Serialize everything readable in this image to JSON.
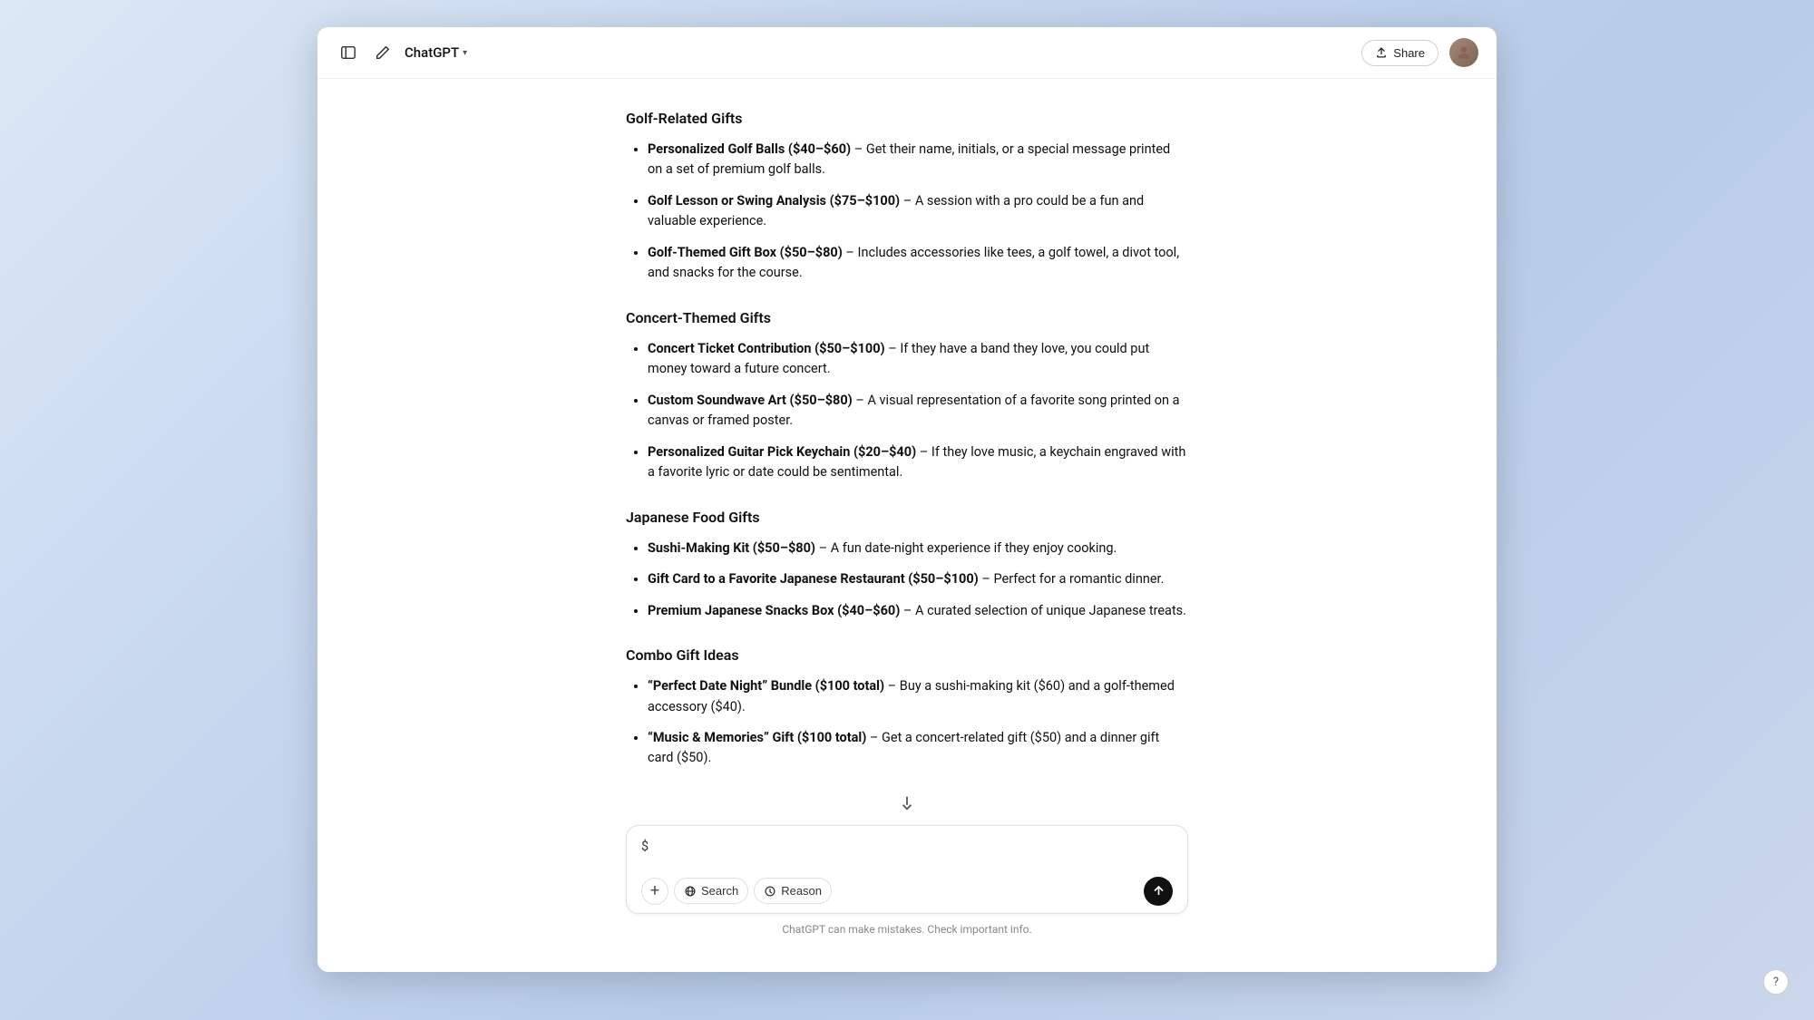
{
  "header": {
    "logo_label": "ChatGPT",
    "chevron": "▾",
    "share_label": "Share",
    "edit_icon": "edit",
    "sidebar_icon": "sidebar",
    "help_label": "?"
  },
  "footer": {
    "note": "ChatGPT can make mistakes. Check important info."
  },
  "input": {
    "placeholder": "$",
    "search_label": "Search",
    "reason_label": "Reason"
  },
  "sections": [
    {
      "id": "golf",
      "heading": "Golf-Related Gifts",
      "items": [
        {
          "name": "Personalized Golf Balls ($40–$60)",
          "desc": " – Get their name, initials, or a special message printed on a set of premium golf balls."
        },
        {
          "name": "Golf Lesson or Swing Analysis ($75–$100)",
          "desc": " – A session with a pro could be a fun and valuable experience."
        },
        {
          "name": "Golf-Themed Gift Box ($50–$80)",
          "desc": " – Includes accessories like tees, a golf towel, a divot tool, and snacks for the course."
        }
      ]
    },
    {
      "id": "concert",
      "heading": "Concert-Themed Gifts",
      "items": [
        {
          "name": "Concert Ticket Contribution ($50–$100)",
          "desc": " – If they have a band they love, you could put money toward a future concert."
        },
        {
          "name": "Custom Soundwave Art ($50–$80)",
          "desc": " – A visual representation of a favorite song printed on a canvas or framed poster."
        },
        {
          "name": "Personalized Guitar Pick Keychain ($20–$40)",
          "desc": " – If they love music, a keychain engraved with a favorite lyric or date could be sentimental."
        }
      ]
    },
    {
      "id": "japanese",
      "heading": "Japanese Food Gifts",
      "items": [
        {
          "name": "Sushi-Making Kit ($50–$80)",
          "desc": " – A fun date-night experience if they enjoy cooking."
        },
        {
          "name": "Gift Card to a Favorite Japanese Restaurant ($50–$100)",
          "desc": " – Perfect for a romantic dinner."
        },
        {
          "name": "Premium Japanese Snacks Box ($40–$60)",
          "desc": " – A curated selection of unique Japanese treats."
        }
      ]
    },
    {
      "id": "combo",
      "heading": "Combo Gift Ideas",
      "items": [
        {
          "name": "“Perfect Date Night” Bundle ($100 total)",
          "desc": " – Buy a sushi-making kit ($60) and a golf-themed accessory ($40)."
        },
        {
          "name": "“Music & Memories” Gift ($100 total)",
          "desc": " – Get a concert-related gift ($50) and a dinner gift card ($50)."
        }
      ]
    }
  ]
}
